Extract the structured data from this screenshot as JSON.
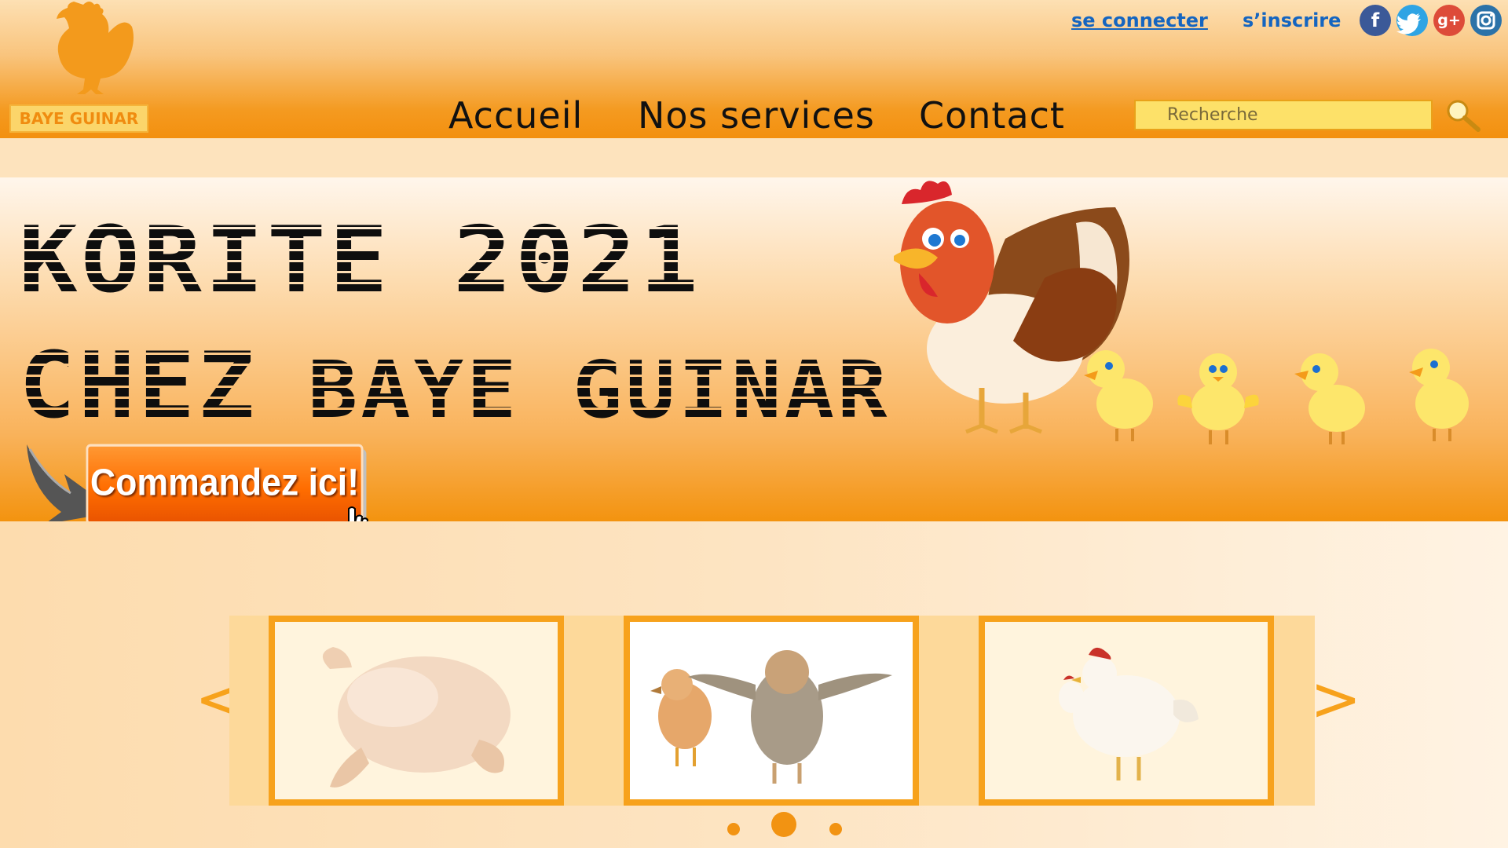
{
  "brand": {
    "name": "BAYE GUINAR"
  },
  "top_links": {
    "login": "se connecter",
    "signup": "s’inscrire"
  },
  "social": [
    {
      "name": "facebook",
      "glyph": "f"
    },
    {
      "name": "twitter",
      "glyph": "t"
    },
    {
      "name": "google-plus",
      "glyph": "g+"
    },
    {
      "name": "instagram",
      "glyph": "◎"
    }
  ],
  "nav": {
    "home": "Accueil",
    "services": "Nos services",
    "contact": "Contact"
  },
  "search": {
    "placeholder": "Recherche"
  },
  "banner": {
    "line1": "KORITE 2021",
    "line2a": "CHEZ",
    "line2b": "BAYE GUINAR",
    "cta": "Commandez ici!"
  },
  "carousel": {
    "prev": "<",
    "next": ">",
    "slides": [
      {
        "name": "raw-chicken"
      },
      {
        "name": "chicks"
      },
      {
        "name": "hens"
      }
    ],
    "active_index": 1
  },
  "colors": {
    "accent": "#f3900f",
    "link": "#1565c0",
    "frame": "#f7a21c"
  }
}
